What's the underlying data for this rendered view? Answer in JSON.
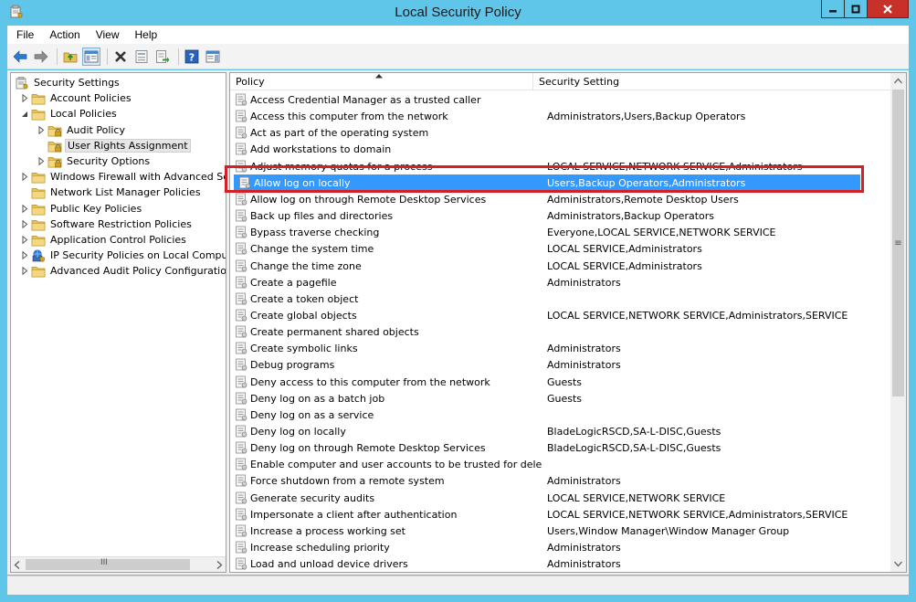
{
  "window": {
    "title": "Local Security Policy"
  },
  "menu": [
    "File",
    "Action",
    "View",
    "Help"
  ],
  "tree": {
    "root": "Security Settings",
    "items": [
      {
        "label": "Account Policies",
        "level": 1,
        "expander": "collapsed",
        "selected": false
      },
      {
        "label": "Local Policies",
        "level": 1,
        "expander": "expanded",
        "selected": false
      },
      {
        "label": "Audit Policy",
        "level": 2,
        "expander": "collapsed",
        "selected": false
      },
      {
        "label": "User Rights Assignment",
        "level": 2,
        "expander": "none",
        "selected": true
      },
      {
        "label": "Security Options",
        "level": 2,
        "expander": "collapsed",
        "selected": false
      },
      {
        "label": "Windows Firewall with Advanced Secu",
        "level": 1,
        "expander": "collapsed",
        "selected": false
      },
      {
        "label": "Network List Manager Policies",
        "level": 1,
        "expander": "none",
        "selected": false
      },
      {
        "label": "Public Key Policies",
        "level": 1,
        "expander": "collapsed",
        "selected": false
      },
      {
        "label": "Software Restriction Policies",
        "level": 1,
        "expander": "collapsed",
        "selected": false
      },
      {
        "label": "Application Control Policies",
        "level": 1,
        "expander": "collapsed",
        "selected": false
      },
      {
        "label": "IP Security Policies on Local Compute",
        "level": 1,
        "expander": "collapsed",
        "selected": false,
        "icon": "ipsec-icon"
      },
      {
        "label": "Advanced Audit Policy Configuration",
        "level": 1,
        "expander": "collapsed",
        "selected": false
      }
    ]
  },
  "list": {
    "columns": {
      "policy": "Policy",
      "setting": "Security Setting"
    },
    "rows": [
      {
        "policy": "Access Credential Manager as a trusted caller",
        "setting": ""
      },
      {
        "policy": "Access this computer from the network",
        "setting": "Administrators,Users,Backup Operators"
      },
      {
        "policy": "Act as part of the operating system",
        "setting": ""
      },
      {
        "policy": "Add workstations to domain",
        "setting": ""
      },
      {
        "policy": "Adjust memory quotas for a process",
        "setting": "LOCAL SERVICE,NETWORK SERVICE,Administrators"
      },
      {
        "policy": "Allow log on locally",
        "setting": "Users,Backup Operators,Administrators",
        "selected": true
      },
      {
        "policy": "Allow log on through Remote Desktop Services",
        "setting": "Administrators,Remote Desktop Users"
      },
      {
        "policy": "Back up files and directories",
        "setting": "Administrators,Backup Operators"
      },
      {
        "policy": "Bypass traverse checking",
        "setting": "Everyone,LOCAL SERVICE,NETWORK SERVICE"
      },
      {
        "policy": "Change the system time",
        "setting": "LOCAL SERVICE,Administrators"
      },
      {
        "policy": "Change the time zone",
        "setting": "LOCAL SERVICE,Administrators"
      },
      {
        "policy": "Create a pagefile",
        "setting": "Administrators"
      },
      {
        "policy": "Create a token object",
        "setting": ""
      },
      {
        "policy": "Create global objects",
        "setting": "LOCAL SERVICE,NETWORK SERVICE,Administrators,SERVICE"
      },
      {
        "policy": "Create permanent shared objects",
        "setting": ""
      },
      {
        "policy": "Create symbolic links",
        "setting": "Administrators"
      },
      {
        "policy": "Debug programs",
        "setting": "Administrators"
      },
      {
        "policy": "Deny access to this computer from the network",
        "setting": "Guests"
      },
      {
        "policy": "Deny log on as a batch job",
        "setting": "Guests"
      },
      {
        "policy": "Deny log on as a service",
        "setting": ""
      },
      {
        "policy": "Deny log on locally",
        "setting": "BladeLogicRSCD,SA-L-DISC,Guests"
      },
      {
        "policy": "Deny log on through Remote Desktop Services",
        "setting": "BladeLogicRSCD,SA-L-DISC,Guests"
      },
      {
        "policy": "Enable computer and user accounts to be trusted for delega...",
        "setting": ""
      },
      {
        "policy": "Force shutdown from a remote system",
        "setting": "Administrators"
      },
      {
        "policy": "Generate security audits",
        "setting": "LOCAL SERVICE,NETWORK SERVICE"
      },
      {
        "policy": "Impersonate a client after authentication",
        "setting": "LOCAL SERVICE,NETWORK SERVICE,Administrators,SERVICE"
      },
      {
        "policy": "Increase a process working set",
        "setting": "Users,Window Manager\\Window Manager Group"
      },
      {
        "policy": "Increase scheduling priority",
        "setting": "Administrators"
      },
      {
        "policy": "Load and unload device drivers",
        "setting": "Administrators"
      }
    ]
  },
  "scroll": {
    "tree_h_label": "III",
    "list_v_label": "≡"
  },
  "colors": {
    "titlebar": "#5fc6ea",
    "selection": "#3399ff",
    "highlight": "#d32027",
    "close": "#c7312a"
  }
}
